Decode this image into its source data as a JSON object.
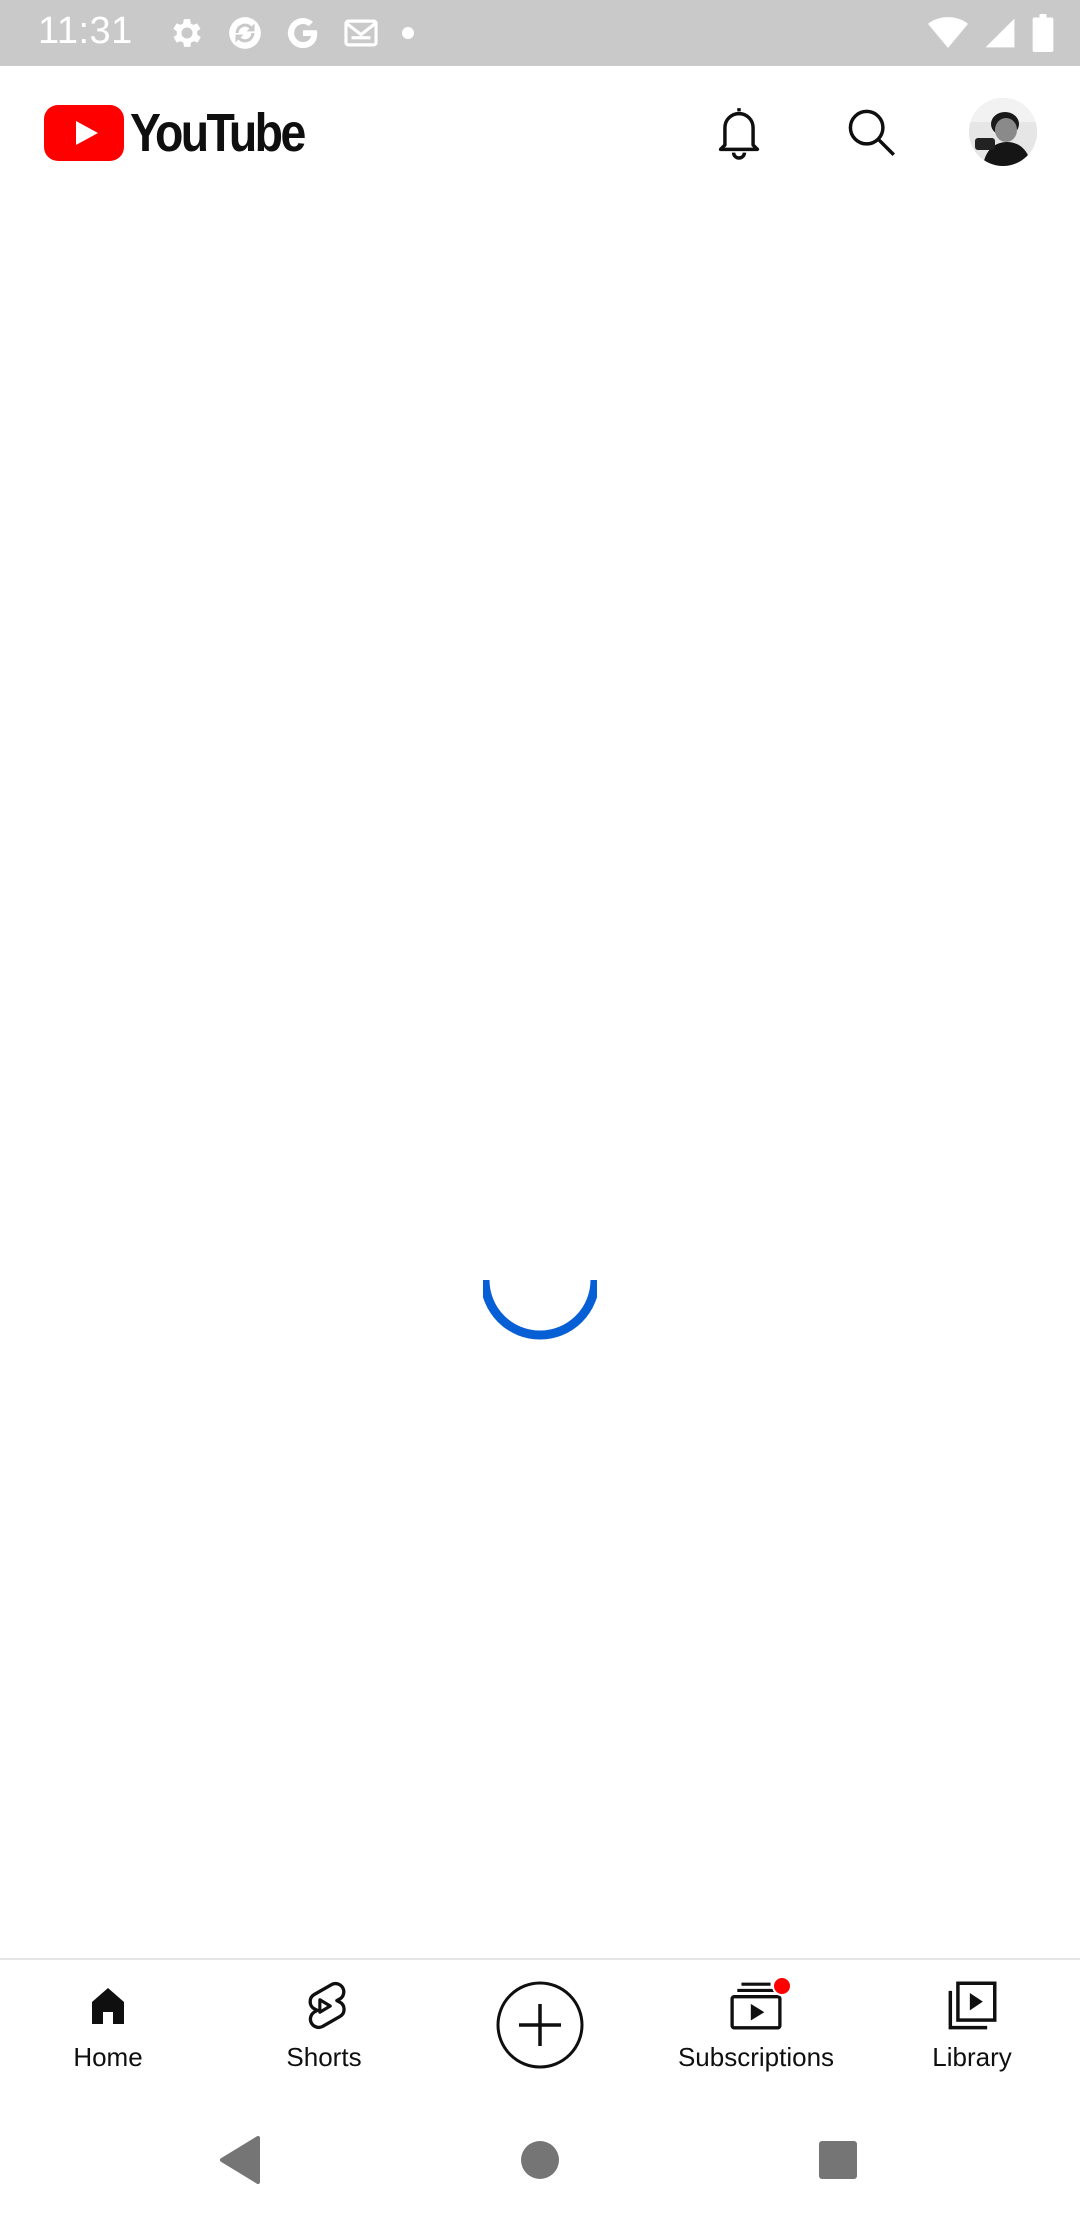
{
  "status_bar": {
    "time": "11:31",
    "icons": [
      "settings-icon",
      "sync-icon",
      "google-icon",
      "gmail-icon",
      "notification-dot",
      "wifi-icon",
      "signal-icon",
      "battery-icon"
    ]
  },
  "header": {
    "logo_text": "YouTube",
    "brand_color": "#ff0000",
    "icons": [
      "bell-icon",
      "search-icon",
      "avatar"
    ]
  },
  "content": {
    "state": "loading",
    "spinner_color": "#065fd4"
  },
  "bottom_nav": {
    "items": [
      {
        "label": "Home",
        "icon": "home-icon",
        "selected": true
      },
      {
        "label": "Shorts",
        "icon": "shorts-icon"
      },
      {
        "label": "",
        "icon": "create-icon"
      },
      {
        "label": "Subscriptions",
        "icon": "subscriptions-icon",
        "badge": true
      },
      {
        "label": "Library",
        "icon": "library-icon"
      }
    ]
  },
  "system_nav": {
    "icons": [
      "back-icon",
      "home-circle-icon",
      "recents-icon"
    ]
  }
}
